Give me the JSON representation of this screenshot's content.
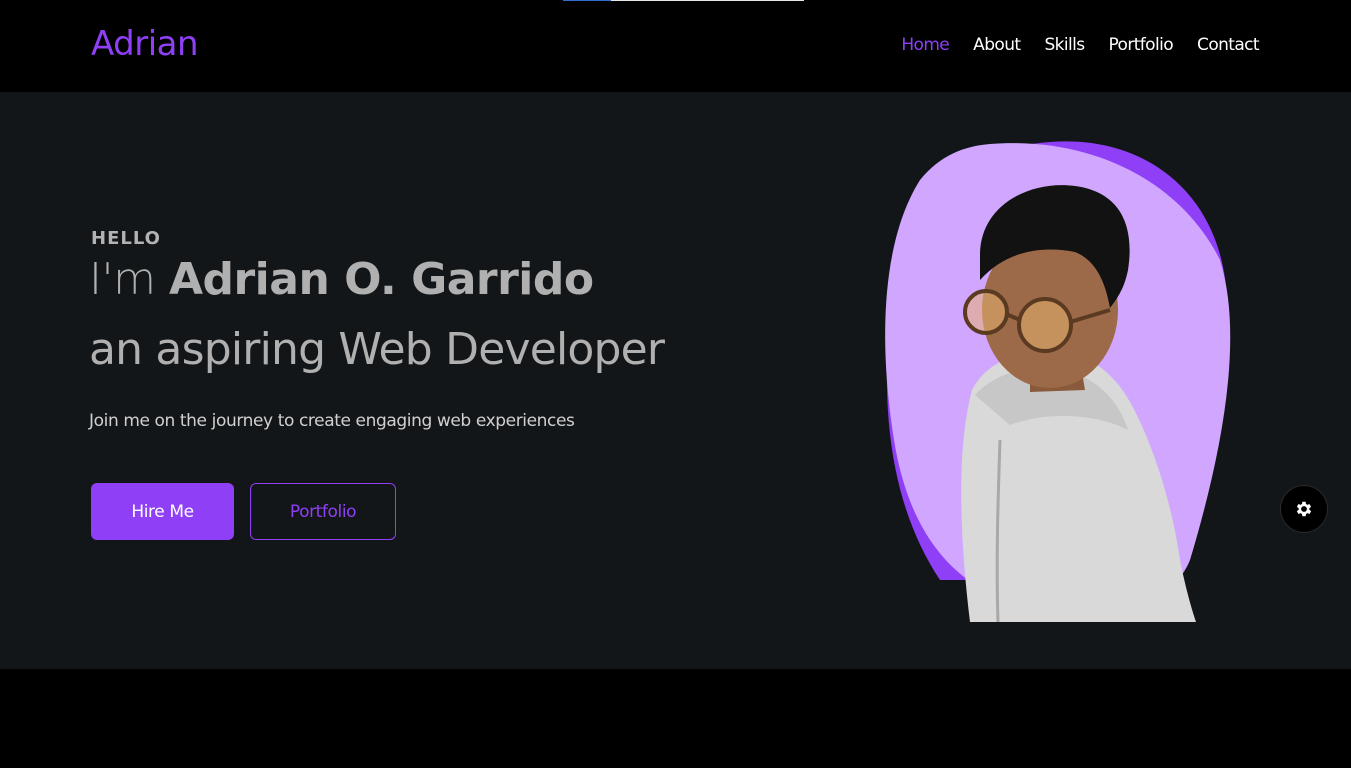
{
  "page_load": {
    "progress": 0.2
  },
  "header": {
    "brand": "Adrian",
    "nav": [
      {
        "label": "Home",
        "active": true
      },
      {
        "label": "About",
        "active": false
      },
      {
        "label": "Skills",
        "active": false
      },
      {
        "label": "Portfolio",
        "active": false
      },
      {
        "label": "Contact",
        "active": false
      }
    ]
  },
  "hero": {
    "greeting": "HELLO",
    "intro_prefix": "I'm",
    "name": "Adrian O. Garrido",
    "role": "an aspiring Web Developer",
    "tagline": "Join me on the journey to create engaging web experiences",
    "hire_button": "Hire Me",
    "portfolio_button": "Portfolio"
  },
  "settings": {
    "icon": "gear-icon"
  },
  "colors": {
    "accent": "#8f3ff5",
    "accent_light": "#d1a6ff",
    "hero_bg": "#131618",
    "nav_bg": "#000000",
    "text_muted": "#b0b0b0"
  }
}
